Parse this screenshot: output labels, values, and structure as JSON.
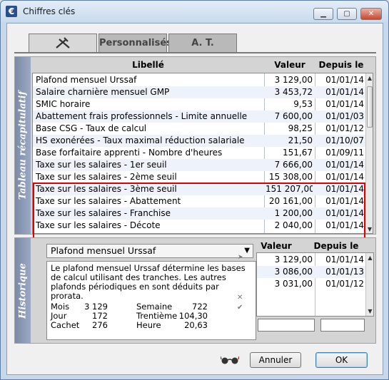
{
  "window": {
    "title": "Chiffres clés",
    "app_icon": "€"
  },
  "tabs": [
    {
      "label": "",
      "icon": "tools-icon"
    },
    {
      "label": "Personnalisés"
    },
    {
      "label": "A. T."
    }
  ],
  "recap": {
    "side_label": "Tableau récapitulatif",
    "headers": {
      "libelle": "Libellé",
      "valeur": "Valeur",
      "depuis": "Depuis le"
    },
    "rows": [
      {
        "libelle": "Plafond mensuel Urssaf",
        "valeur": "3 129,00",
        "depuis": "01/01/14"
      },
      {
        "libelle": "Salaire charnière mensuel GMP",
        "valeur": "3 453,72",
        "depuis": "01/01/14"
      },
      {
        "libelle": "SMIC horaire",
        "valeur": "9,53",
        "depuis": "01/01/14"
      },
      {
        "libelle": "Abattement frais professionnels - Limite annuelle",
        "valeur": "7 600,00",
        "depuis": "01/01/03"
      },
      {
        "libelle": "Base CSG - Taux de calcul",
        "valeur": "98,25",
        "depuis": "01/01/12"
      },
      {
        "libelle": "HS exonérées - Taux maximal réduction salariale",
        "valeur": "21,50",
        "depuis": "01/10/07"
      },
      {
        "libelle": "Base forfaitaire apprenti - Nombre d'heures",
        "valeur": "151,67",
        "depuis": "01/09/11"
      },
      {
        "libelle": "Taxe sur les salaires - 1er seuil",
        "valeur": "7 666,00",
        "depuis": "01/01/14"
      },
      {
        "libelle": "Taxe sur les salaires - 2ème seuil",
        "valeur": "15 308,00",
        "depuis": "01/01/14"
      },
      {
        "libelle": "Taxe sur les salaires - 3ème seuil",
        "valeur": "151 207,00",
        "depuis": "01/01/14"
      },
      {
        "libelle": "Taxe sur les salaires - Abattement",
        "valeur": "20 161,00",
        "depuis": "01/01/14"
      },
      {
        "libelle": "Taxe sur les salaires - Franchise",
        "valeur": "1 200,00",
        "depuis": "01/01/14"
      },
      {
        "libelle": "Taxe sur les salaires - Décote",
        "valeur": "2 040,00",
        "depuis": "01/01/14"
      }
    ]
  },
  "historique": {
    "side_label": "Historique",
    "selected": "Plafond mensuel Urssaf",
    "description": "Le plafond mensuel Urssaf détermine les bases de calcul utilisant des tranches. Les autres plafonds périodiques en sont déduits par prorata.",
    "periods": [
      {
        "label": "Mois",
        "value": "3 129"
      },
      {
        "label": "Semaine",
        "value": "722"
      },
      {
        "label": "Jour",
        "value": "172"
      },
      {
        "label": "Trentième",
        "value": "104,30"
      },
      {
        "label": "Cachet",
        "value": "276"
      },
      {
        "label": "Heure",
        "value": "20,63"
      }
    ],
    "headers": {
      "valeur": "Valeur",
      "depuis": "Depuis le"
    },
    "rows": [
      {
        "valeur": "3 129,00",
        "depuis": "01/01/14"
      },
      {
        "valeur": "3 086,00",
        "depuis": "01/01/13"
      },
      {
        "valeur": "3 031,00",
        "depuis": "01/01/12"
      }
    ],
    "input_valeur": "",
    "input_depuis": ""
  },
  "footer": {
    "cancel_label": "Annuler",
    "ok_label": "OK",
    "glasses_icon": "glasses-icon"
  },
  "colors": {
    "highlight": "#e00000",
    "side_label": "#8797b6"
  }
}
